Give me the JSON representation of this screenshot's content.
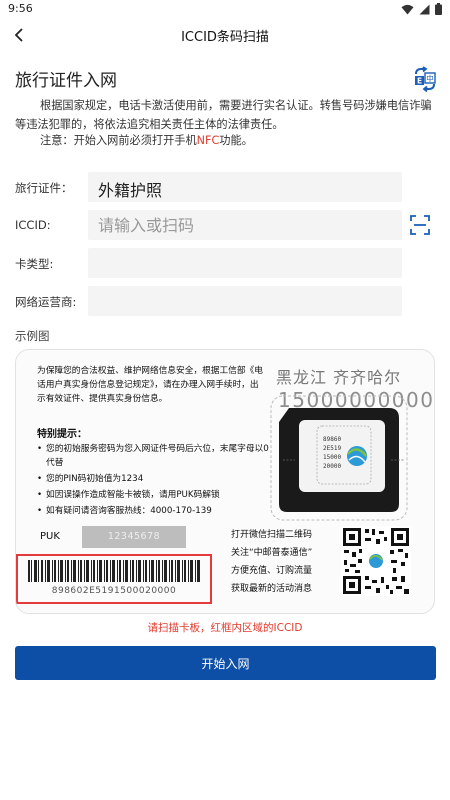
{
  "status_bar": {
    "time": "9:56"
  },
  "app_bar": {
    "title": "ICCID条码扫描"
  },
  "section": {
    "title": "旅行证件入网"
  },
  "notice": {
    "text": "根据国家规定，电话卡激活使用前，需要进行实名认证。转售号码涉嫌电信诈骗等违法犯罪的，将依法追究相关责任主体的法律责任。",
    "nfc_prefix": "注意：开始入网前必须打开手机",
    "nfc_highlight": "NFC",
    "nfc_suffix": "功能。"
  },
  "form": {
    "travel_doc": {
      "label": "旅行证件：",
      "value": "外籍护照"
    },
    "iccid": {
      "label": "ICCID:",
      "placeholder": "请输入或扫码"
    },
    "card_type": {
      "label": "卡类型:",
      "value": ""
    },
    "operator": {
      "label": "网络运营商:",
      "value": ""
    }
  },
  "example": {
    "label": "示例图",
    "intro": "为保障您的合法权益、维护网络信息安全，根据工信部《电话用户真实身份信息登记规定》，请在办理入网手续时，出示有效证件、提供真实身份信息。",
    "region": "黑龙江  齐齐哈尔",
    "phone_number": "15000000000",
    "tips_title": "特别提示：",
    "tips": [
      "您的初始服务密码为您入网证件号码后六位，末尾字母以0代替",
      "您的PIN码初始值为1234",
      "如因误操作造成智能卡被锁，请用PUK码解锁",
      "如有疑问请咨询客服热线：4000-170-139"
    ],
    "sim_chip": [
      "89860",
      "2E519",
      "15000",
      "20000"
    ],
    "puk_label": "PUK",
    "puk_value": "12345678",
    "iccid_value": "898602E5191500020000",
    "qr_lines": [
      "打开微信扫描二维码",
      "关注“中邮普泰通信”",
      "方便充值、订购流量",
      "获取最新的活动消息"
    ]
  },
  "scan_hint": "请扫描卡板，红框内区域的ICCID",
  "start_button": {
    "label": "开始入网"
  },
  "colors": {
    "accent": "#0d4ea6",
    "highlight": "#e23b2e",
    "nfc": "#e23b2e"
  }
}
